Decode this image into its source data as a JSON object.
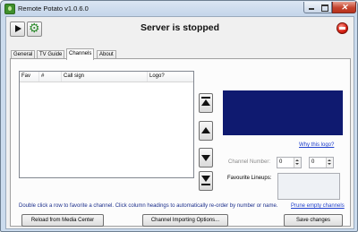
{
  "window": {
    "title": "Remote Potato v1.0.6.0",
    "minimize_icon": "minimize-icon",
    "maximize_icon": "maximize-icon",
    "close_icon": "close-icon"
  },
  "toolbar": {
    "status": "Server is stopped",
    "play_icon": "play-icon",
    "settings_icon": "gear-icon",
    "stop_icon": "stop-server-icon"
  },
  "tabs": [
    {
      "label": "General",
      "active": false
    },
    {
      "label": "TV Guide",
      "active": false
    },
    {
      "label": "Channels",
      "active": true
    },
    {
      "label": "About",
      "active": false
    }
  ],
  "channel_list": {
    "columns": [
      "Fav",
      "#",
      "Call sign",
      "Logo?"
    ],
    "rows": []
  },
  "arrange_buttons": {
    "move_top_icon": "move-to-top-icon",
    "move_up_icon": "move-up-icon",
    "move_down_icon": "move-down-icon",
    "move_bottom_icon": "move-to-bottom-icon"
  },
  "details": {
    "logo_color": "#0f1a70",
    "why_logo_link": "Why this logo?",
    "channel_number_label": "Channel Number:",
    "channel_number_value": "0",
    "channel_subnumber_value": "0",
    "favourite_lineups_label": "Favourite Lineups:"
  },
  "footer": {
    "hint": "Double click a row to favorite a channel.  Click column headings to automatically re-order by number or name.",
    "prune_link": "Prune empty channels",
    "reload_button": "Reload from Media Center",
    "importing_button": "Channel Importing Options...",
    "save_button": "Save changes"
  }
}
